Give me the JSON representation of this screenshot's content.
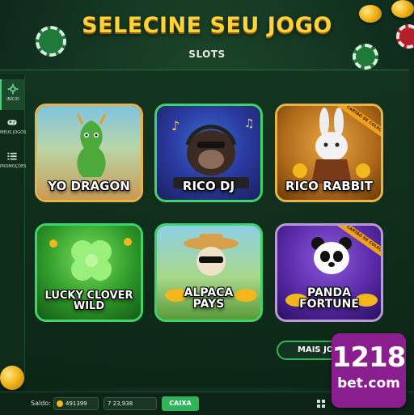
{
  "header": {
    "title": "SELECINE SEU JOGO",
    "subtitle": "SLOTS"
  },
  "sidebar": {
    "items": [
      {
        "label": "INÍCIO",
        "icon": "settings-gear-icon",
        "active": true
      },
      {
        "label": "MEUS JOGOS",
        "icon": "gamepad-icon",
        "active": false
      },
      {
        "label": "PROMOÇÕES",
        "icon": "list-icon",
        "active": false
      }
    ]
  },
  "games": [
    {
      "name": "YO DRAGON",
      "ribbon": ""
    },
    {
      "name": "RICO DJ",
      "ribbon": ""
    },
    {
      "name": "RICO RABBIT",
      "ribbon": "CARTÃO DE COLEÇÃO"
    },
    {
      "name": "LUCKY CLOVER WILD",
      "ribbon": ""
    },
    {
      "name": "ALPACA PAYS",
      "ribbon": ""
    },
    {
      "name": "PANDA FORTUNE",
      "ribbon": "CARTÃO DE COLEÇÃO"
    }
  ],
  "more_button": {
    "label": "MAIS JOGOS"
  },
  "footer": {
    "saldo_label": "Saldo:",
    "balance_value": "491399",
    "second_value": "7 23,938",
    "caixa_label": "CAIXA"
  },
  "logo": {
    "number": "1218",
    "domain": "bet.com"
  },
  "colors": {
    "accent_green": "#2fb45a",
    "title_gold": "#ffd23a",
    "logo_purple": "#8b1e8e"
  }
}
